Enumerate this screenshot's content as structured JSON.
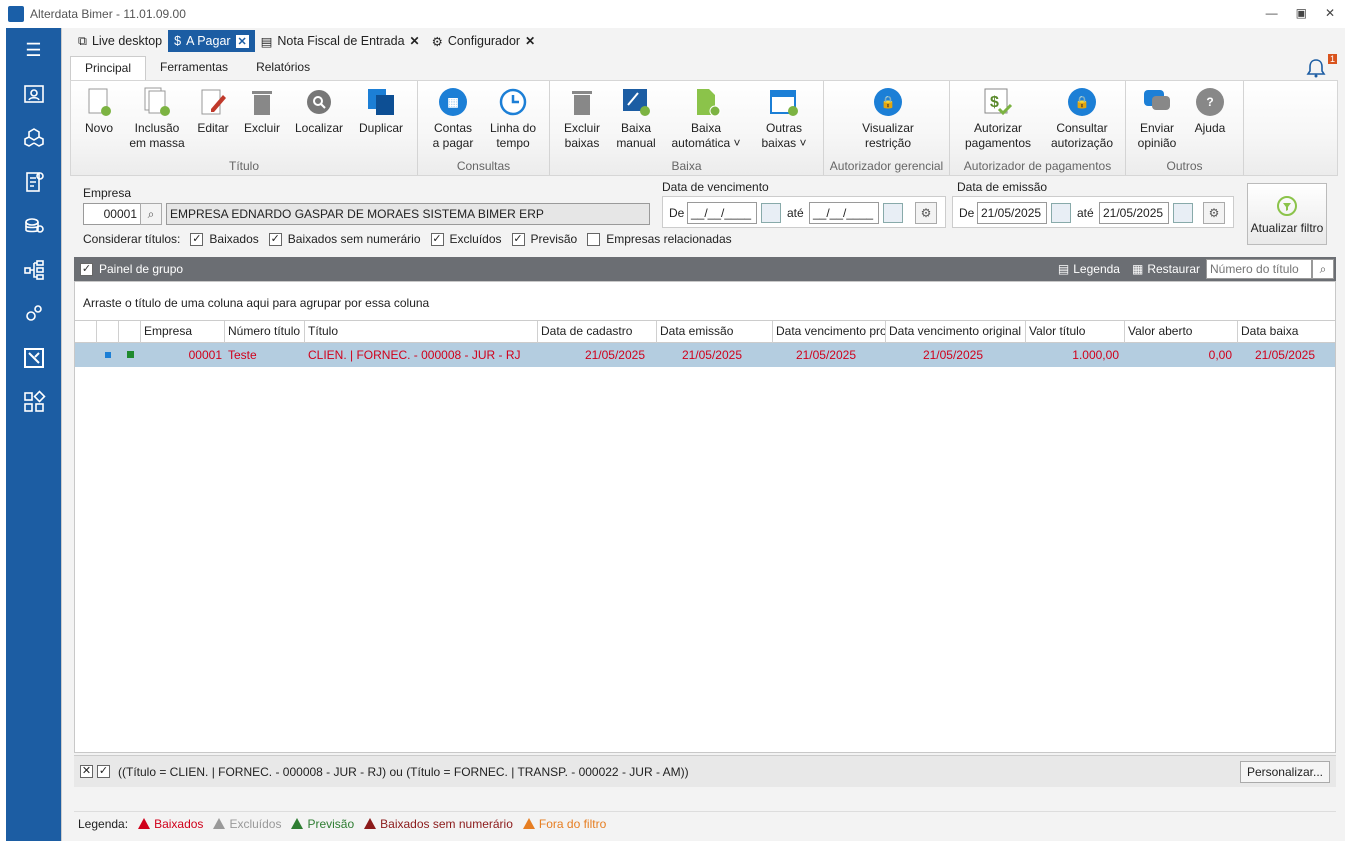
{
  "app": {
    "title": "Alterdata Bimer - 11.01.09.00"
  },
  "doc_tabs": [
    {
      "label": "Live desktop"
    },
    {
      "label": "A Pagar"
    },
    {
      "label": "Nota Fiscal de Entrada"
    },
    {
      "label": "Configurador"
    }
  ],
  "ribbon_tabs": [
    "Principal",
    "Ferramentas",
    "Relatórios"
  ],
  "notification_count": "1",
  "ribbon": {
    "groups": [
      "Título",
      "Consultas",
      "Baixa",
      "Autorizador gerencial",
      "Autorizador de pagamentos",
      "Outros"
    ],
    "buttons": {
      "novo": "Novo",
      "inclusao1": "Inclusão",
      "inclusao2": "em massa",
      "editar": "Editar",
      "excluir": "Excluir",
      "localizar": "Localizar",
      "duplicar": "Duplicar",
      "contas1": "Contas",
      "contas2": "a pagar",
      "linha1": "Linha do",
      "linha2": "tempo",
      "excb1": "Excluir",
      "excb2": "baixas",
      "bm1": "Baixa",
      "bm2": "manual",
      "ba1": "Baixa",
      "ba2": "automática ˅",
      "ob1": "Outras",
      "ob2": "baixas ˅",
      "vr1": "Visualizar",
      "vr2": "restrição",
      "ap1": "Autorizar",
      "ap2": "pagamentos",
      "ca1": "Consultar",
      "ca2": "autorização",
      "eo1": "Enviar",
      "eo2": "opinião",
      "ajuda": "Ajuda"
    }
  },
  "filters": {
    "empresa_label": "Empresa",
    "empresa_code": "00001",
    "empresa_name": "EMPRESA EDNARDO GASPAR DE MORAES SISTEMA BIMER ERP",
    "venc_label": "Data de vencimento",
    "de": "De",
    "ate": "até",
    "venc_de": "__/__/____",
    "venc_ate": "__/__/____",
    "emis_label": "Data de emissão",
    "emis_de": "21/05/2025",
    "emis_ate": "21/05/2025",
    "considerar": "Considerar títulos:",
    "checks": [
      {
        "label": "Baixados",
        "checked": "✓"
      },
      {
        "label": "Baixados sem numerário",
        "checked": "✓"
      },
      {
        "label": "Excluídos",
        "checked": "✓"
      },
      {
        "label": "Previsão",
        "checked": "✓"
      },
      {
        "label": "Empresas relacionadas",
        "checked": ""
      }
    ],
    "refresh": "Atualizar filtro"
  },
  "group_panel": {
    "label": "Painel de grupo",
    "legenda": "Legenda",
    "restaurar": "Restaurar",
    "search_placeholder": "Número do título"
  },
  "grid": {
    "group_hint": "Arraste o título de uma coluna aqui para agrupar por essa coluna",
    "columns": [
      "Empresa",
      "Número título",
      "Título",
      "Data de cadastro",
      "Data emissão",
      "Data vencimento prorrogado",
      "Data vencimento original",
      "Valor título",
      "Valor aberto",
      "Data baixa"
    ],
    "rows": [
      {
        "empresa": "00001",
        "numero": "Teste",
        "titulo": "CLIEN. | FORNEC. - 000008 - JUR - RJ",
        "cadastro": "21/05/2025",
        "emissao": "21/05/2025",
        "venc_prorrogado": "21/05/2025",
        "venc_original": "21/05/2025",
        "valor": "1.000,00",
        "aberto": "0,00",
        "baixa": "21/05/2025"
      }
    ]
  },
  "filter_bar": {
    "expression": "((Título = CLIEN. | FORNEC. - 000008 - JUR - RJ) ou (Título = FORNEC. | TRANSP. - 000022 - JUR - AM))",
    "customize": "Personalizar..."
  },
  "legend": {
    "label": "Legenda:",
    "items": [
      {
        "label": "Baixados",
        "color": "#d0011b"
      },
      {
        "label": "Excluídos",
        "color": "#999999"
      },
      {
        "label": "Previsão",
        "color": "#2e7d32"
      },
      {
        "label": "Baixados sem numerário",
        "color": "#8b1a1a"
      },
      {
        "label": "Fora do filtro",
        "color": "#e67e22"
      }
    ]
  }
}
